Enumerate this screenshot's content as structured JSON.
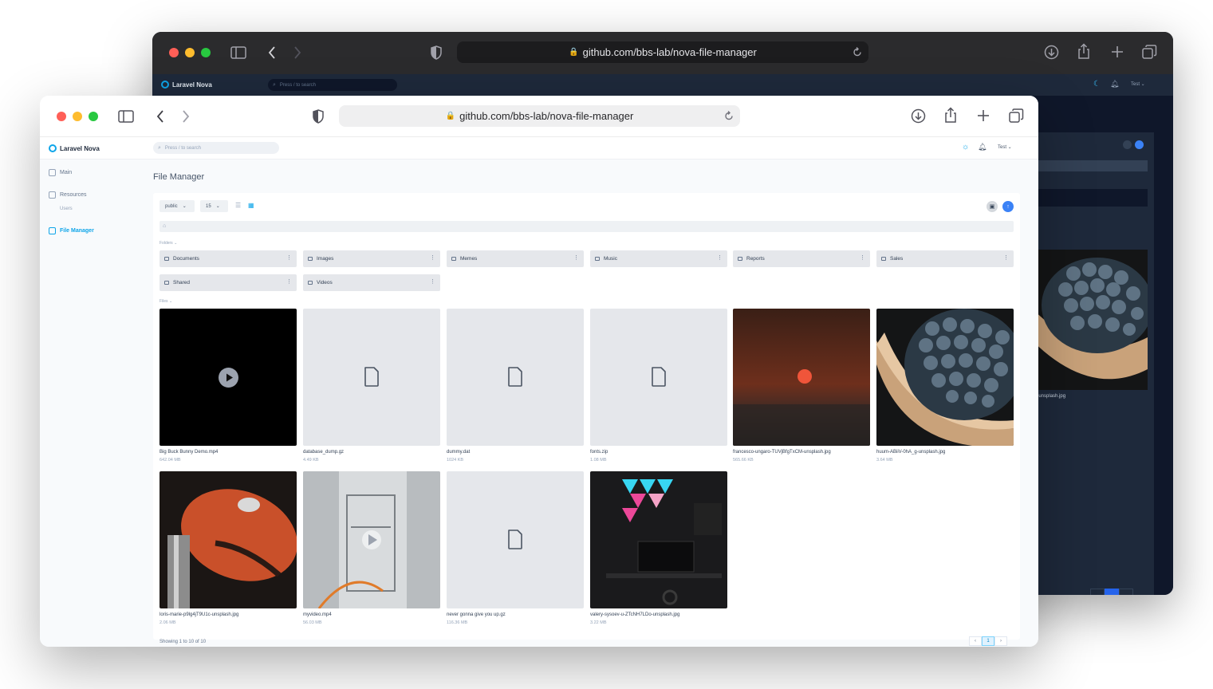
{
  "back_window": {
    "url": "github.com/bbs-lab/nova-file-manager",
    "app_name": "Laravel Nova",
    "search_placeholder": "Press / to search",
    "user_menu": "Test",
    "file_name": "huum-ABiiV-0hA_g-unsplash.jpg",
    "file_name_visible": "-0hA_g-unsplash.jpg"
  },
  "front_window": {
    "url": "github.com/bbs-lab/nova-file-manager",
    "app_name": "Laravel Nova",
    "search_placeholder": "Press / to search",
    "user_menu": "Test",
    "sidebar": {
      "items": [
        {
          "label": "Main",
          "icon": "grid-icon"
        },
        {
          "label": "Resources",
          "icon": "database-icon"
        },
        {
          "label": "Users",
          "sub": true
        },
        {
          "label": "File Manager",
          "icon": "folder-icon",
          "active": true
        }
      ]
    },
    "page_title": "File Manager",
    "toolbar": {
      "disk": "public",
      "per_page": "15"
    },
    "sections": {
      "folders": "Folders",
      "files": "Files"
    },
    "folders": [
      "Documents",
      "Images",
      "Memes",
      "Music",
      "Reports",
      "Sales",
      "Shared",
      "Videos"
    ],
    "files": [
      {
        "name": "Big Buck Bunny Demo.mp4",
        "size": "642.04 MB",
        "kind": "video"
      },
      {
        "name": "database_dump.gz",
        "size": "4.49 KB",
        "kind": "doc"
      },
      {
        "name": "dummy.dat",
        "size": "1024 KB",
        "kind": "doc"
      },
      {
        "name": "fonts.zip",
        "size": "1.08 MB",
        "kind": "doc"
      },
      {
        "name": "francesco-ungaro-TUVjBfgTxCM-unsplash.jpg",
        "size": "565.66 KB",
        "kind": "sunset"
      },
      {
        "name": "huum-ABiiV-0hA_g-unsplash.jpg",
        "size": "3.64 MB",
        "kind": "stones"
      },
      {
        "name": "loris-marie-p9lg4jT9U1c-unsplash.jpg",
        "size": "2.06 MB",
        "kind": "moto"
      },
      {
        "name": "myvideo.mp4",
        "size": "56.03 MB",
        "kind": "factory"
      },
      {
        "name": "never gonna give you up.gz",
        "size": "116.36 MB",
        "kind": "doc"
      },
      {
        "name": "valery-sysoev-u-ZTcNH7LDo-unsplash.jpg",
        "size": "3.22 MB",
        "kind": "desk"
      }
    ],
    "pagination": {
      "text": "Showing 1 to 10 of 10",
      "current": "1"
    }
  },
  "colors": {
    "accent": "#0ea5e9",
    "dark_bg": "#0f172a"
  }
}
